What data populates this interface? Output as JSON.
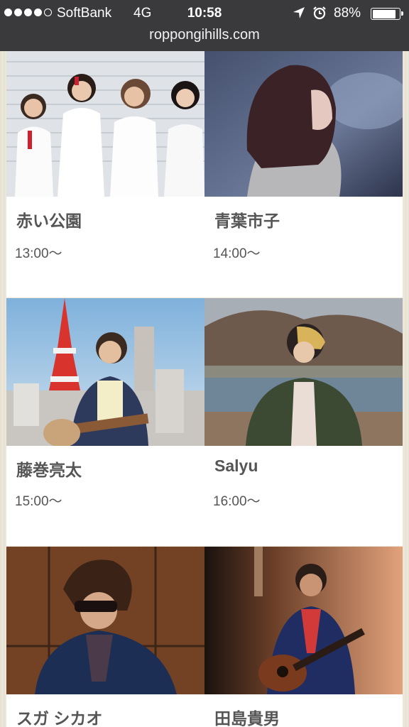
{
  "status_bar": {
    "carrier": "SoftBank",
    "network": "4G",
    "time": "10:58",
    "battery": "88%",
    "battery_level": 0.88,
    "icons": [
      "signal-dots",
      "location-arrow-icon",
      "alarm-clock-icon",
      "battery-icon"
    ]
  },
  "browser": {
    "url": "roppongihills.com"
  },
  "artists": [
    {
      "name": "赤い公園",
      "time": "13:00〜"
    },
    {
      "name": "青葉市子",
      "time": "14:00〜"
    },
    {
      "name": "藤巻亮太",
      "time": "15:00〜"
    },
    {
      "name": "Salyu",
      "time": "16:00〜"
    },
    {
      "name": "スガ シカオ",
      "time": ""
    },
    {
      "name": "田島貴男",
      "time": ""
    }
  ]
}
